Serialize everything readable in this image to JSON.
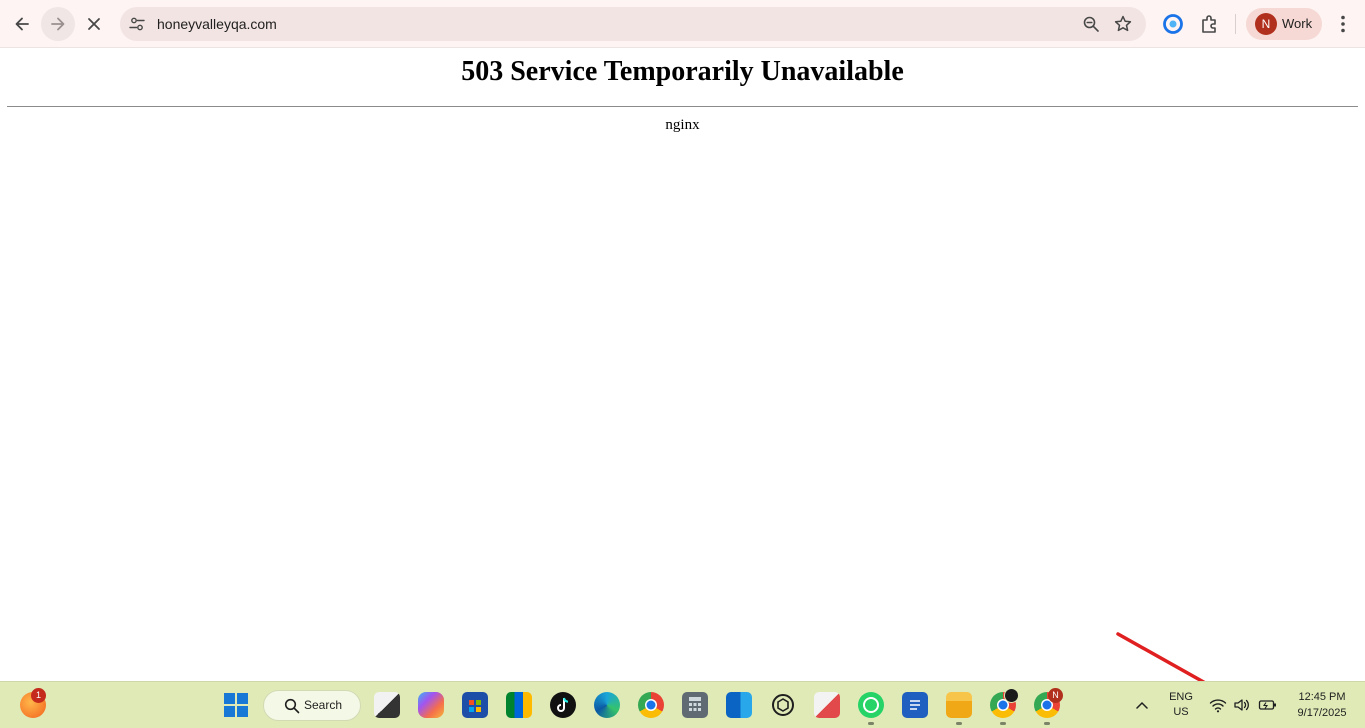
{
  "browser": {
    "url": "honeyvalleyqa.com",
    "profile_initial": "N",
    "profile_label": "Work"
  },
  "page": {
    "heading": "503 Service Temporarily Unavailable",
    "server": "nginx"
  },
  "taskbar": {
    "search_label": "Search",
    "notification_count": "1",
    "chrome_profile_badge": "N",
    "language": "ENG",
    "region": "US",
    "time": "12:45 PM",
    "date": "9/17/2025"
  },
  "colors": {
    "toolbar_bg": "#fdf4f3",
    "omnibox_bg": "#f2e4e3",
    "taskbar_bg": "#dfeab7",
    "annotation_arrow": "#e02020"
  }
}
